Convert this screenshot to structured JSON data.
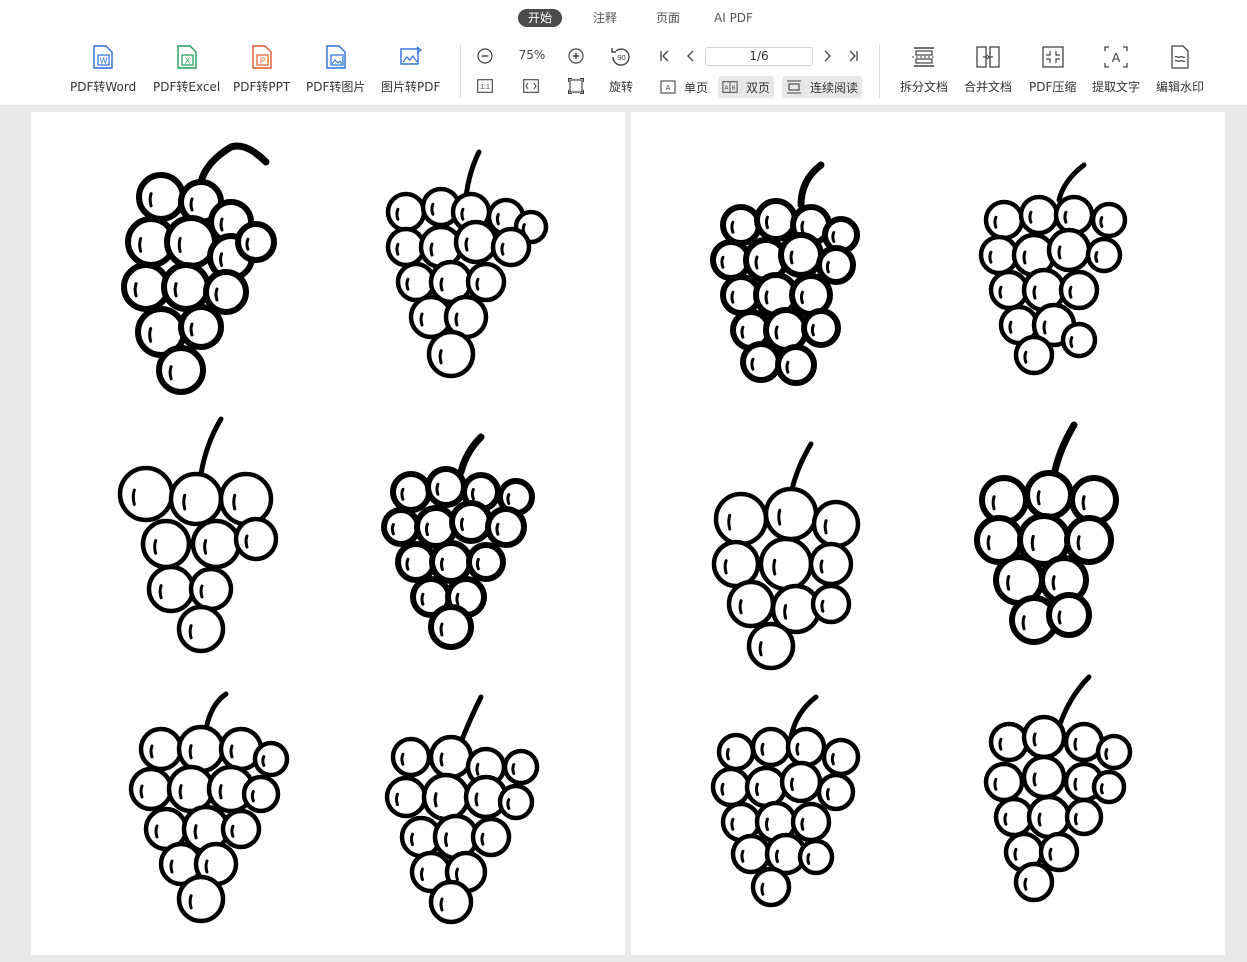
{
  "tabs": [
    "开始",
    "注释",
    "页面",
    "AI PDF"
  ],
  "active_tab": "开始",
  "convert_tools": [
    {
      "label": "PDF转Word",
      "icon": "pdf-to-word-icon",
      "color": "#2b6fd8",
      "letter": "W"
    },
    {
      "label": "PDF转Excel",
      "icon": "pdf-to-excel-icon",
      "color": "#1f9d55",
      "letter": "X"
    },
    {
      "label": "PDF转PPT",
      "icon": "pdf-to-ppt-icon",
      "color": "#e0592a",
      "letter": "P"
    },
    {
      "label": "PDF转图片",
      "icon": "pdf-to-image-icon",
      "color": "#2b6fd8",
      "letter": ""
    },
    {
      "label": "图片转PDF",
      "icon": "image-to-pdf-icon",
      "color": "#2b6fd8",
      "letter": ""
    }
  ],
  "zoom": {
    "value": "75%"
  },
  "rotate_label": "旋转",
  "page_nav": {
    "current": "1/6"
  },
  "view_modes": {
    "single": "单页",
    "double": "双页",
    "continuous": "连续阅读"
  },
  "doc_tools": [
    {
      "label": "拆分文档",
      "icon": "split-document-icon"
    },
    {
      "label": "合并文档",
      "icon": "merge-document-icon"
    },
    {
      "label": "PDF压缩",
      "icon": "pdf-compress-icon"
    },
    {
      "label": "提取文字",
      "icon": "extract-text-icon"
    },
    {
      "label": "编辑水印",
      "icon": "edit-watermark-icon"
    }
  ]
}
